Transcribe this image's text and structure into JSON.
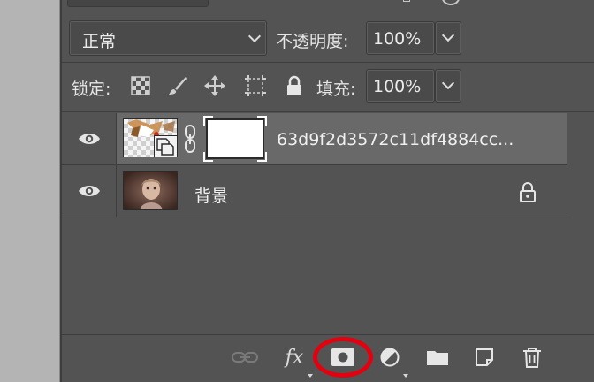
{
  "blend_mode": {
    "selected": "正常"
  },
  "opacity": {
    "label": "不透明度:",
    "value": "100%"
  },
  "lock": {
    "label": "锁定:",
    "icons": [
      "lock-transparent-pixels-icon",
      "lock-image-pixels-icon",
      "lock-position-icon",
      "lock-artboard-icon",
      "lock-all-icon"
    ]
  },
  "fill": {
    "label": "填充:",
    "value": "100%"
  },
  "layers": [
    {
      "name": "63d9f2d3572c11df4884cc...",
      "selected": true,
      "type": "smart-object",
      "has_mask": true
    },
    {
      "name": "背景",
      "selected": false,
      "type": "background",
      "locked": true
    }
  ],
  "bottom_toolbar": {
    "icons": [
      "link-layers-icon",
      "layer-style-fx-icon",
      "add-mask-icon",
      "adjustment-layer-icon",
      "group-folder-icon",
      "new-layer-icon",
      "delete-trash-icon"
    ],
    "fx_label": "fx"
  },
  "colors": {
    "panel": "#535353",
    "selected_row": "#696969",
    "annotation_ring": "#e3000f"
  }
}
